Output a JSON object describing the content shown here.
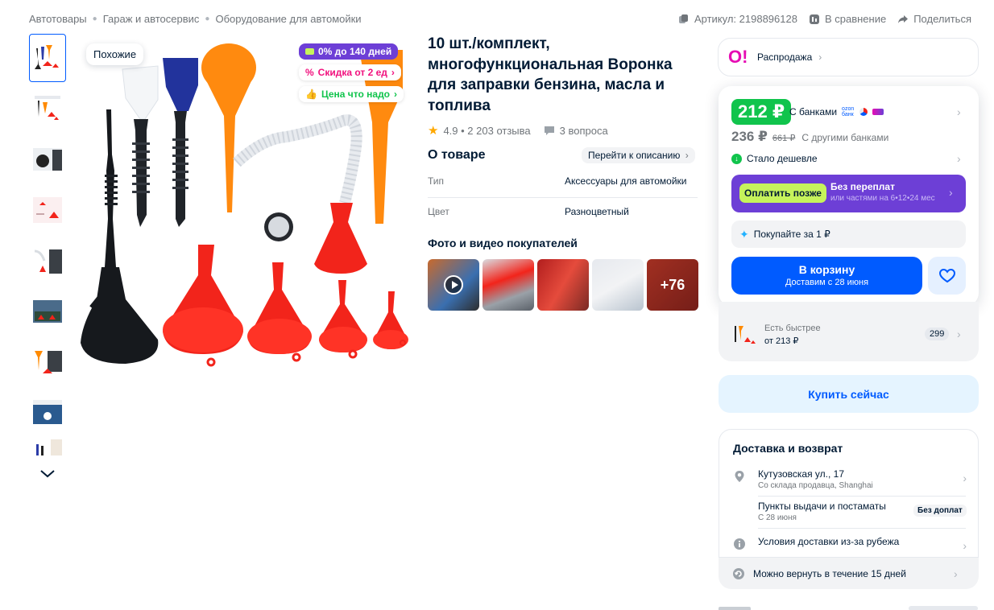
{
  "breadcrumbs": [
    "Автотовары",
    "Гараж и автосервис",
    "Оборудование для автомойки"
  ],
  "meta": {
    "article": "Артикул: 2198896128",
    "compare": "В сравнение",
    "share": "Поделиться"
  },
  "gallery": {
    "similar_label": "Похожие",
    "badges": {
      "installment": "0% до 140 дней",
      "discount": "Скидка от 2 ед",
      "good_price": "Цена что надо"
    }
  },
  "product": {
    "title": "10 шт./комплект, многофункциональная Воронка для заправки бензина, масла и топлива",
    "rating": "4.9 • 2 203 отзыва",
    "questions": "3 вопроса"
  },
  "about": {
    "heading": "О товаре",
    "goto_description": "Перейти к описанию",
    "specs": [
      {
        "key": "Тип",
        "value": "Аксессуары для автомойки"
      },
      {
        "key": "Цвет",
        "value": "Разноцветный"
      }
    ]
  },
  "photos": {
    "heading": "Фото и видео покупателей",
    "more_count": "+76"
  },
  "sale": {
    "label": "Распродажа"
  },
  "pricing": {
    "bank_price": "212 ₽",
    "bank_label": "С банками",
    "bank_logo": "ozon банк",
    "other_price": "236 ₽",
    "old_price": "661 ₽",
    "other_label": "С другими банками",
    "cheaper": "Стало дешевле",
    "pay_later_button": "Оплатить позже",
    "pay_later_title": "Без переплат",
    "pay_later_sub": "или частями на 6•12•24 мес",
    "buy_for": "Покупайте за 1 ₽",
    "cart_label": "В корзину",
    "cart_sub": "Доставим с 28 июня"
  },
  "faster": {
    "label": "Есть быстрее",
    "price": "от 213 ₽",
    "count": "299"
  },
  "buy_now": "Купить сейчас",
  "delivery": {
    "heading": "Доставка и возврат",
    "address": "Кутузовская ул., 17",
    "address_sub": "Со склада продавца, Shanghai",
    "pickup": "Пункты выдачи и постаматы",
    "pickup_sub": "С 28 июня",
    "pickup_badge": "Без доплат",
    "abroad": "Условия доставки из-за рубежа",
    "return": "Можно вернуть в течение 15 дней"
  },
  "colors": {
    "accent": "#005bff",
    "green": "#10c44c",
    "purple": "#6d3fd6",
    "pink": "#f1117e",
    "red": "#f2241b",
    "orange": "#ff8a00"
  }
}
